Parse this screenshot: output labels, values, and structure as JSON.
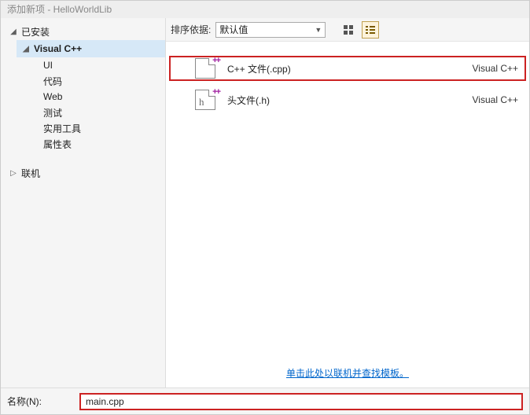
{
  "window": {
    "title": "添加新项 - HelloWorldLib"
  },
  "sidebar": {
    "installed": {
      "label": "已安装",
      "expanded": true
    },
    "vcpp": {
      "label": "Visual C++",
      "expanded": true
    },
    "children": [
      {
        "label": "UI"
      },
      {
        "label": "代码"
      },
      {
        "label": "Web"
      },
      {
        "label": "测试"
      },
      {
        "label": "实用工具"
      },
      {
        "label": "属性表"
      }
    ],
    "online": {
      "label": "联机",
      "expanded": false
    }
  },
  "toolbar": {
    "sort_label": "排序依据:",
    "sort_value": "默认值"
  },
  "items": [
    {
      "label": "C++ 文件(.cpp)",
      "category": "Visual C++",
      "glyph": ""
    },
    {
      "label": "头文件(.h)",
      "category": "Visual C++",
      "glyph": "h"
    }
  ],
  "link": {
    "text": "单击此处以联机并查找模板。"
  },
  "footer": {
    "name_label": "名称(N):",
    "name_value": "main.cpp"
  }
}
